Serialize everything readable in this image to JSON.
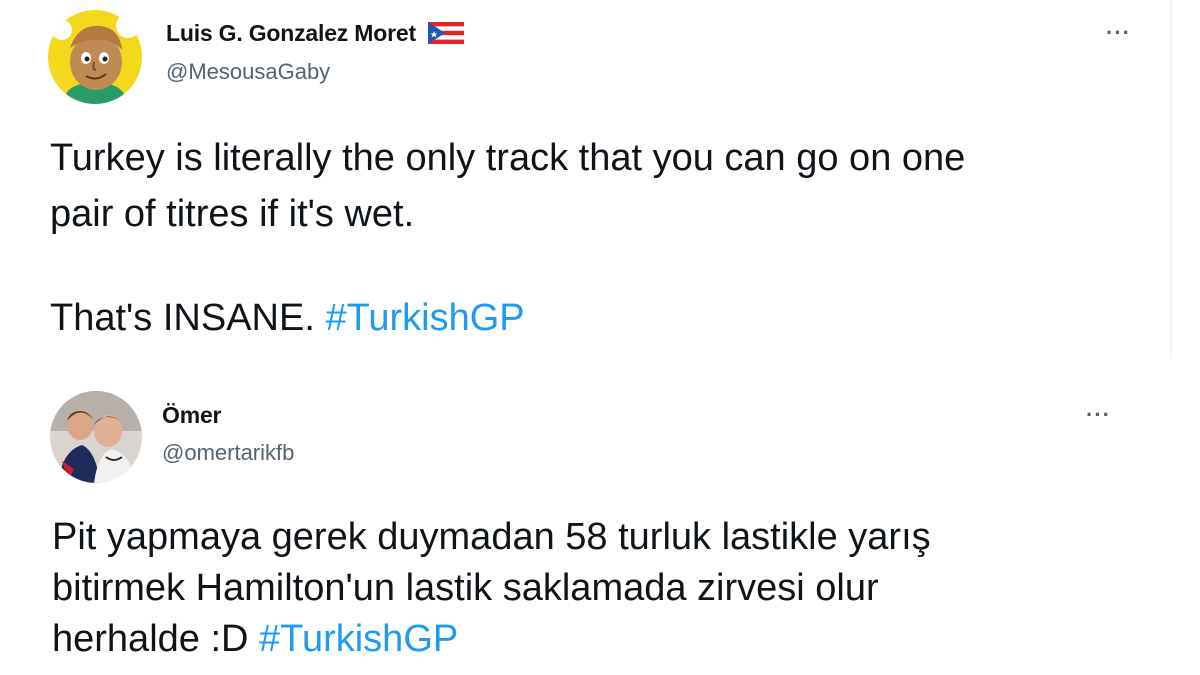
{
  "tweets": [
    {
      "display_name": "Luis G. Gonzalez Moret",
      "flag_icon": "puerto-rico-flag-icon",
      "handle": "@MesousaGaby",
      "more_label": "···",
      "lines": [
        "Turkey is literally the only track that you can go on one",
        "pair of titres if it's wet."
      ],
      "last_line_text": "That's INSANE. ",
      "hashtag": "#TurkishGP"
    },
    {
      "display_name": "Ömer",
      "handle": "@omertarikfb",
      "more_label": "···",
      "lines": [
        "Pit yapmaya gerek duymadan 58 turluk lastikle yarış",
        "bitirmek Hamilton'un lastik saklamada zirvesi olur"
      ],
      "last_line_text": "herhalde :D ",
      "hashtag": "#TurkishGP"
    }
  ],
  "colors": {
    "text": "#0f1419",
    "secondary": "#536471",
    "hashtag": "#1d9bf0"
  }
}
